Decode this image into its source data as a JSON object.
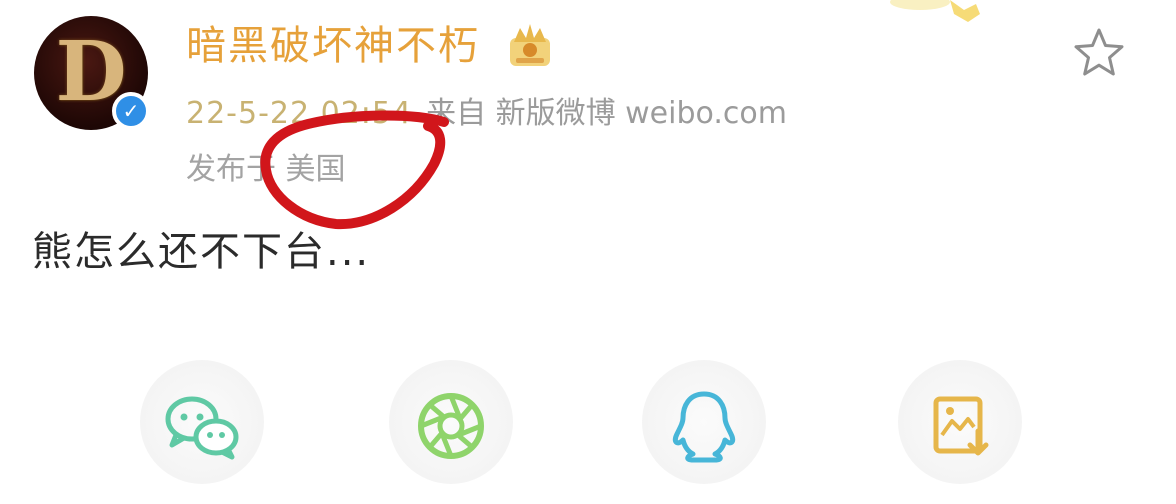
{
  "post": {
    "author": {
      "name": "暗黑破坏神不朽",
      "avatar_letter": "D",
      "verified_mark": "✓",
      "badge_icon": "crown-badge-icon"
    },
    "timestamp": "22-5-22 02:54",
    "source": "来自 新版微博 weibo.com",
    "location": "发布于 美国",
    "text": "熊怎么还不下台...",
    "favorite_icon": "star-outline-icon"
  },
  "share_targets": [
    {
      "icon": "wechat-icon",
      "color": "#5fc9a4"
    },
    {
      "icon": "moments-icon",
      "color": "#8fd46b"
    },
    {
      "icon": "qq-icon",
      "color": "#47b6d8"
    },
    {
      "icon": "save-image-icon",
      "color": "#e6b64a"
    }
  ],
  "colors": {
    "username": "#e6a13a",
    "timestamp": "#c8b272",
    "meta": "#9b9b9b",
    "verified": "#2f8fe6",
    "annotation": "#d1161b"
  }
}
